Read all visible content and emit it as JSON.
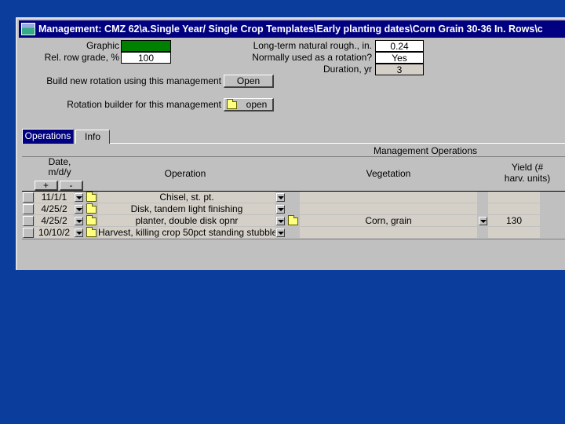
{
  "window": {
    "title": "Management:  CMZ 62\\a.Single Year/ Single Crop Templates\\Early planting dates\\Corn Grain 30-36 In. Rows\\c"
  },
  "properties": {
    "graphic_label": "Graphic",
    "graphic_color": "#008000",
    "row_grade_label": "Rel. row grade, %",
    "row_grade_value": "100",
    "roughness_label": "Long-term natural rough., in.",
    "roughness_value": "0.24",
    "rotation_label": "Normally used as a rotation?",
    "rotation_value": "Yes",
    "duration_label": "Duration, yr",
    "duration_value": "3"
  },
  "actions": {
    "build_label": "Build new rotation using this management",
    "build_button": "Open",
    "rotation_builder_label": "Rotation builder for this management",
    "rotation_builder_button": "open"
  },
  "tabs": [
    {
      "label": "Operations",
      "active": true
    },
    {
      "label": "Info",
      "active": false
    }
  ],
  "grid": {
    "group_header": "Management Operations",
    "headers": {
      "date": "Date,\nm/d/y",
      "operation": "Operation",
      "vegetation": "Vegetation",
      "yield": "Yield (#\nharv. units)"
    },
    "add_button": "+",
    "remove_button": "-",
    "rows": [
      {
        "date": "11/1/1",
        "operation": "Chisel, st. pt.",
        "vegetation": "",
        "yield": ""
      },
      {
        "date": "4/25/2",
        "operation": "Disk, tandem light finishing",
        "vegetation": "",
        "yield": ""
      },
      {
        "date": "4/25/2",
        "operation": "planter, double disk opnr",
        "vegetation": "Corn, grain",
        "yield": "130"
      },
      {
        "date": "10/10/2",
        "operation": "Harvest, killing crop 50pct standing stubble",
        "vegetation": "",
        "yield": ""
      }
    ]
  }
}
